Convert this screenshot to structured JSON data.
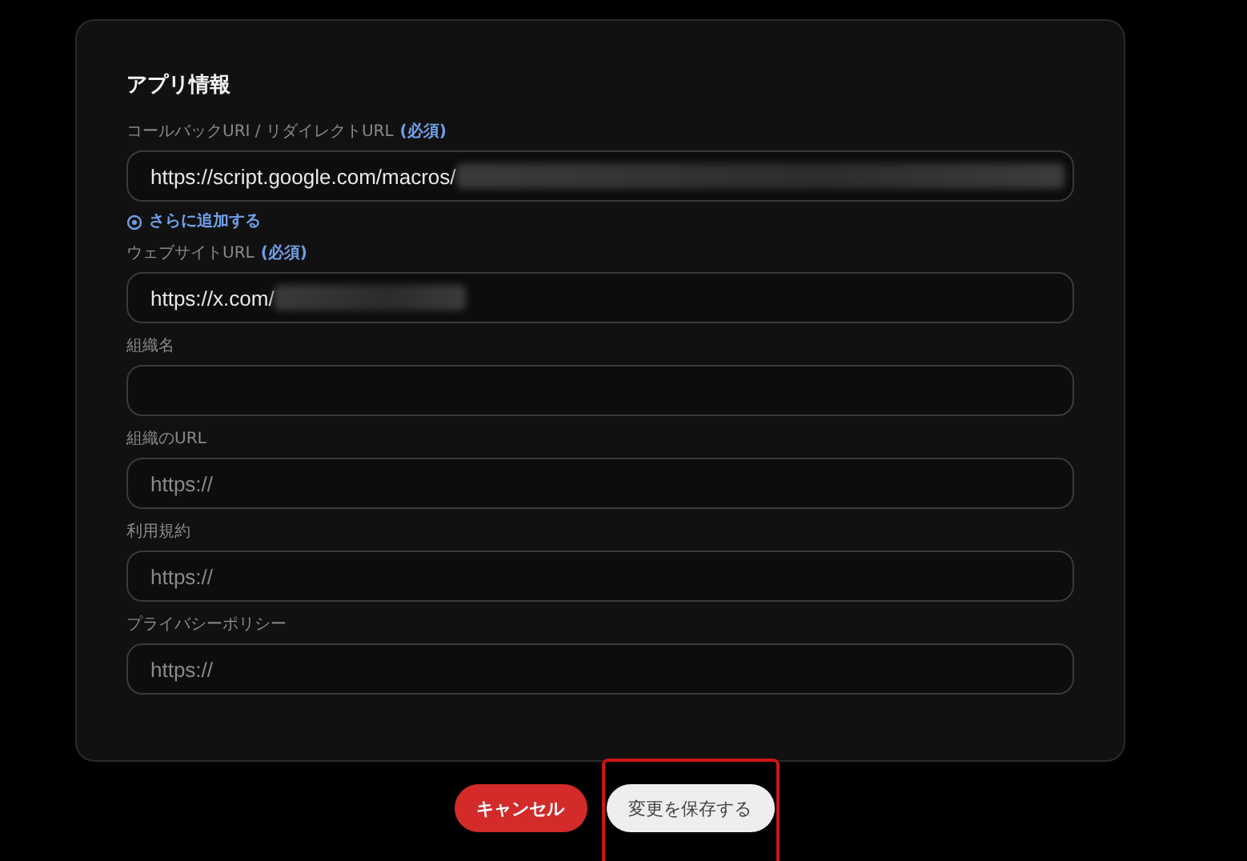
{
  "section": {
    "title": "アプリ情報"
  },
  "fields": [
    {
      "label": "コールバックURI / リダイレクトURL",
      "required": "(必須)",
      "value": "https://script.google.com/macros/",
      "redacted": true,
      "add_link": "さらに追加する"
    },
    {
      "label": "ウェブサイトURL",
      "required": "(必須)",
      "value": "https://x.com/",
      "redacted": true
    },
    {
      "label": "組織名"
    },
    {
      "label": "組織のURL",
      "placeholder": "https://"
    },
    {
      "label": "利用規約",
      "placeholder": "https://"
    },
    {
      "label": "プライバシーポリシー",
      "placeholder": "https://"
    }
  ],
  "buttons": [
    {
      "kind": "cancel",
      "label": "キャンセル",
      "highlighted": false
    },
    {
      "kind": "save",
      "label": "変更を保存する",
      "highlighted": true
    }
  ]
}
